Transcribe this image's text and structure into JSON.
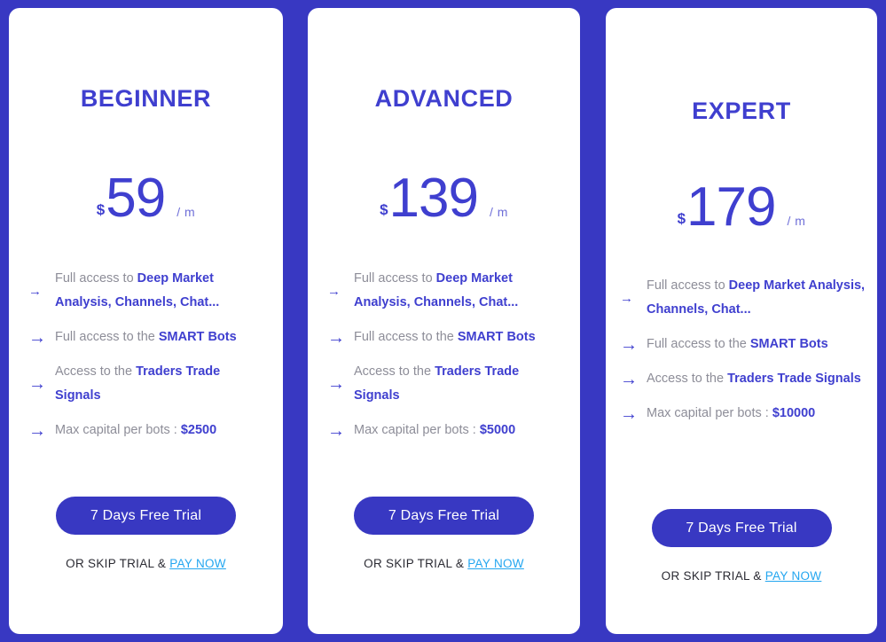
{
  "theme": {
    "background": "#3838c2",
    "card_background": "#ffffff",
    "accent": "#3f3fcf",
    "muted_text": "#8d8d98",
    "link": "#23a6f0",
    "button_background": "#3838c2",
    "button_text": "#ffffff"
  },
  "plans": [
    {
      "name": "BEGINNER",
      "currency": "$",
      "amount": "59",
      "period": "/ m",
      "features": [
        {
          "arrow": "arrow-right-icon",
          "arrow_style": "thin",
          "pre": "Full access to ",
          "strong": "Deep Market Analysis, Channels, Chat...",
          "post": ""
        },
        {
          "arrow": "arrow-right-icon",
          "arrow_style": "bold",
          "pre": "Full access to the ",
          "strong": "SMART Bots",
          "post": ""
        },
        {
          "arrow": "arrow-right-icon",
          "arrow_style": "bold",
          "pre": "Access to the ",
          "strong": "Traders Trade Signals",
          "post": ""
        },
        {
          "arrow": "arrow-right-icon",
          "arrow_style": "bold",
          "pre": "Max capital per bots : ",
          "strong": "$2500",
          "post": ""
        }
      ],
      "trial_button": "7 Days Free Trial",
      "skip_prefix": "OR SKIP TRIAL & ",
      "pay_now": "PAY NOW"
    },
    {
      "name": "ADVANCED",
      "currency": "$",
      "amount": "139",
      "period": "/ m",
      "features": [
        {
          "arrow": "arrow-right-icon",
          "arrow_style": "thin",
          "pre": "Full access to ",
          "strong": "Deep Market Analysis, Channels, Chat...",
          "post": ""
        },
        {
          "arrow": "arrow-right-icon",
          "arrow_style": "bold",
          "pre": "Full access to the ",
          "strong": "SMART Bots",
          "post": ""
        },
        {
          "arrow": "arrow-right-icon",
          "arrow_style": "bold",
          "pre": "Access to the ",
          "strong": "Traders Trade Signals",
          "post": ""
        },
        {
          "arrow": "arrow-right-icon",
          "arrow_style": "bold",
          "pre": "Max capital per bots : ",
          "strong": "$5000",
          "post": ""
        }
      ],
      "trial_button": "7 Days Free Trial",
      "skip_prefix": "OR SKIP TRIAL & ",
      "pay_now": "PAY NOW"
    },
    {
      "name": "EXPERT",
      "currency": "$",
      "amount": "179",
      "period": "/ m",
      "features": [
        {
          "arrow": "arrow-right-icon",
          "arrow_style": "thin",
          "pre": "Full access to ",
          "strong": "Deep Market Analysis, Channels, Chat...",
          "post": ""
        },
        {
          "arrow": "arrow-right-icon",
          "arrow_style": "bold",
          "pre": "Full access to the ",
          "strong": "SMART Bots",
          "post": ""
        },
        {
          "arrow": "arrow-right-icon",
          "arrow_style": "bold",
          "pre": "Access to the ",
          "strong": "Traders Trade Signals",
          "post": ""
        },
        {
          "arrow": "arrow-right-icon",
          "arrow_style": "bold",
          "pre": "Max capital per bots : ",
          "strong": "$10000",
          "post": ""
        }
      ],
      "trial_button": "7 Days Free Trial",
      "skip_prefix": "OR SKIP TRIAL & ",
      "pay_now": "PAY NOW"
    }
  ],
  "icons": {
    "arrow_right": "→"
  }
}
